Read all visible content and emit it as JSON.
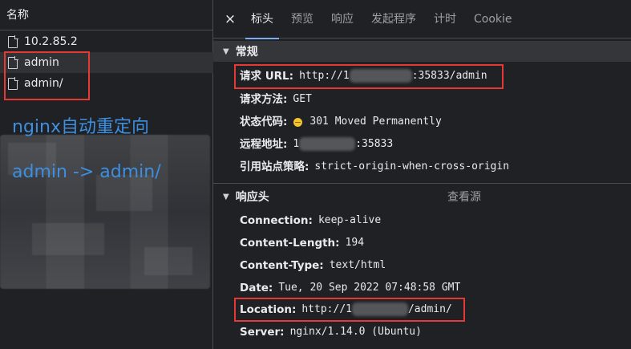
{
  "name_column_header": "名称",
  "requests": [
    {
      "label": "10.2.85.2"
    },
    {
      "label": "admin"
    },
    {
      "label": "admin/"
    }
  ],
  "annotations": {
    "line1": "nginx自动重定向",
    "line2": "admin -> admin/"
  },
  "close_label": "×",
  "tabs": [
    "标头",
    "预览",
    "响应",
    "发起程序",
    "计时",
    "Cookie"
  ],
  "active_tab": "标头",
  "general": {
    "title": "常规",
    "request_url_key": "请求 URL:",
    "request_url_prefix": "http://1",
    "request_url_suffix": ":35833/admin",
    "method_key": "请求方法:",
    "method_value": "GET",
    "status_key": "状态代码:",
    "status_value": "301 Moved Permanently",
    "status_color": "#f4c430",
    "remote_key": "远程地址:",
    "remote_prefix": "1",
    "remote_suffix": ":35833",
    "referrer_key": "引用站点策略:",
    "referrer_value": "strict-origin-when-cross-origin"
  },
  "response_headers": {
    "title": "响应头",
    "view_source": "查看源",
    "connection_key": "Connection:",
    "connection_value": "keep-alive",
    "content_length_key": "Content-Length:",
    "content_length_value": "194",
    "content_type_key": "Content-Type:",
    "content_type_value": "text/html",
    "date_key": "Date:",
    "date_value": "Tue, 20 Sep 2022 07:48:58 GMT",
    "location_key": "Location:",
    "location_prefix": "http://1",
    "location_suffix": "/admin/",
    "server_key": "Server:",
    "server_value": "nginx/1.14.0 (Ubuntu)"
  },
  "colors": {
    "highlight_box": "#e53935",
    "annotation_text": "#3d8fe0",
    "active_tab_underline": "#7cacf8"
  }
}
